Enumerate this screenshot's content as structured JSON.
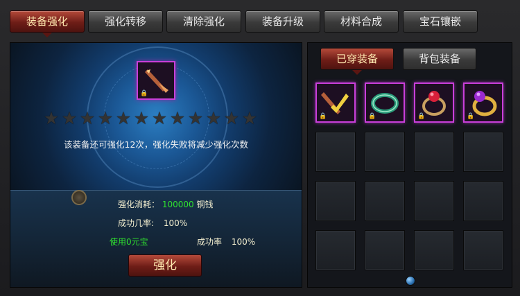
{
  "tabs": [
    "装备强化",
    "强化转移",
    "清除强化",
    "装备升级",
    "材料合成",
    "宝石镶嵌"
  ],
  "enhance": {
    "max_stars": 12,
    "description": "该装备还可强化12次，强化失败将减少强化次数",
    "cost_label": "强化消耗：",
    "cost_amount": "100000",
    "cost_unit": "铜钱",
    "rate_label": "成功几率:",
    "rate_value": "100%",
    "use_ingot_label": "使用0元宝",
    "rate2_label": "成功率",
    "rate2_value": "100%",
    "button": "强化"
  },
  "equipment": {
    "tabs": [
      "已穿装备",
      "背包装备"
    ],
    "items": [
      "weapon-icon",
      "jade-ring-icon",
      "ruby-ring-icon",
      "amethyst-ring-icon"
    ]
  },
  "colors": {
    "accent": "#6e1d17",
    "highlight": "#c93fd9",
    "cost_green": "#2fe02f"
  }
}
